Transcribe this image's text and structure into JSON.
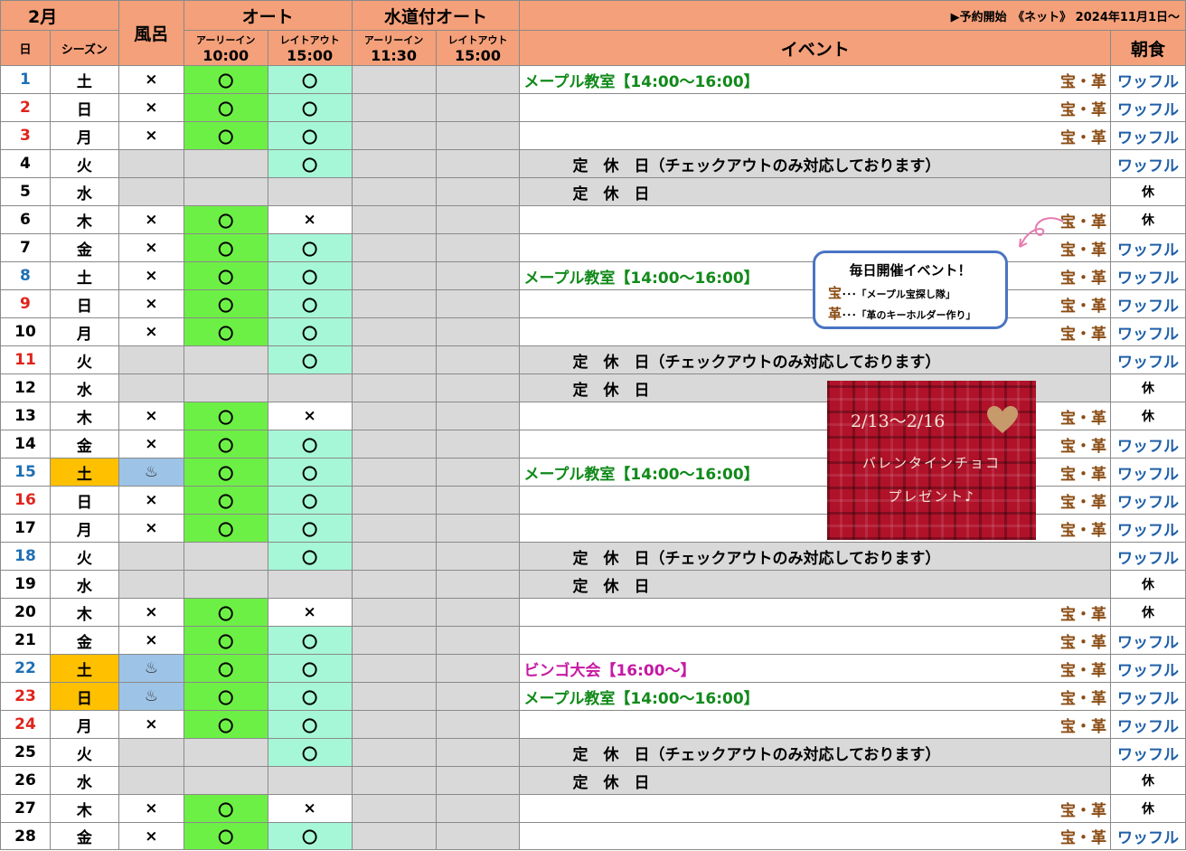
{
  "header": {
    "month": "2月",
    "bath": "風呂",
    "auto": "オート",
    "water_auto": "水道付オート",
    "notice": "▶予約開始　《ネット》 2024年11月1日～",
    "day_col": "日",
    "season_col": "シーズン",
    "early_in": "アーリーイン",
    "late_out": "レイトアウト",
    "auto_in_time": "10:00",
    "auto_out_time": "15:00",
    "water_in_time": "11:30",
    "water_out_time": "15:00",
    "event_col": "イベント",
    "breakfast_col": "朝食"
  },
  "text": {
    "closed_full": "定　休　日（チェックアウトのみ対応しております）",
    "closed": "定　休　日",
    "tags": "宝・革",
    "breakfast_waffle": "ワッフル",
    "breakfast_rest": "休",
    "mark_ok": "〇",
    "mark_ng": "×",
    "onsen": "♨"
  },
  "colors": {
    "header": "#f4a07a",
    "peak": "#ffc000",
    "green_bright": "#6df045",
    "green_mint": "#a6f7d7",
    "grey": "#d9d9d9",
    "blue_day": "#1f6fb4",
    "red_day": "#e0231b"
  },
  "callout": {
    "title": "毎日開催イベント！",
    "line1_key": "宝",
    "line1_text": "･･･「メープル宝探し隊」",
    "line2_key": "革",
    "line2_text": "･･･「革のキーホルダー作り」"
  },
  "valentine": {
    "dates": "2/13～2/16",
    "line1": "バレンタインチョコ",
    "line2": "プレゼント♪"
  },
  "rows": [
    {
      "day": "1",
      "dc": "blue",
      "wd": "土",
      "peak": false,
      "bath": "x",
      "ei": "o",
      "lo": "o",
      "type": "open",
      "event": "メープル教室【14:00～16:00】",
      "ec": "green",
      "tag": true,
      "bf": "w"
    },
    {
      "day": "2",
      "dc": "red",
      "wd": "日",
      "peak": false,
      "bath": "x",
      "ei": "o",
      "lo": "o",
      "type": "open",
      "event": "",
      "ec": "",
      "tag": true,
      "bf": "w"
    },
    {
      "day": "3",
      "dc": "red",
      "wd": "月",
      "peak": false,
      "bath": "x",
      "ei": "o",
      "lo": "o",
      "type": "open",
      "event": "",
      "ec": "",
      "tag": true,
      "bf": "w"
    },
    {
      "day": "4",
      "dc": "black",
      "wd": "火",
      "peak": false,
      "bath": "",
      "ei": "",
      "lo": "o",
      "type": "closed_co",
      "bf": "w"
    },
    {
      "day": "5",
      "dc": "black",
      "wd": "水",
      "peak": false,
      "bath": "",
      "ei": "",
      "lo": "",
      "type": "closed",
      "bf": "r"
    },
    {
      "day": "6",
      "dc": "black",
      "wd": "木",
      "peak": false,
      "bath": "x",
      "ei": "o",
      "lo": "x",
      "type": "open",
      "event": "",
      "ec": "",
      "tag": true,
      "bf": "r"
    },
    {
      "day": "7",
      "dc": "black",
      "wd": "金",
      "peak": false,
      "bath": "x",
      "ei": "o",
      "lo": "o",
      "type": "open",
      "event": "",
      "ec": "",
      "tag": true,
      "bf": "w"
    },
    {
      "day": "8",
      "dc": "blue",
      "wd": "土",
      "peak": false,
      "bath": "x",
      "ei": "o",
      "lo": "o",
      "type": "open",
      "event": "メープル教室【14:00～16:00】",
      "ec": "green",
      "tag": true,
      "bf": "w"
    },
    {
      "day": "9",
      "dc": "red",
      "wd": "日",
      "peak": false,
      "bath": "x",
      "ei": "o",
      "lo": "o",
      "type": "open",
      "event": "",
      "ec": "",
      "tag": true,
      "bf": "w"
    },
    {
      "day": "10",
      "dc": "black",
      "wd": "月",
      "peak": false,
      "bath": "x",
      "ei": "o",
      "lo": "o",
      "type": "open",
      "event": "",
      "ec": "",
      "tag": true,
      "bf": "w"
    },
    {
      "day": "11",
      "dc": "red",
      "wd": "火",
      "peak": false,
      "bath": "",
      "ei": "",
      "lo": "o",
      "type": "closed_co",
      "bf": "w"
    },
    {
      "day": "12",
      "dc": "black",
      "wd": "水",
      "peak": false,
      "bath": "",
      "ei": "",
      "lo": "",
      "type": "closed",
      "bf": "r"
    },
    {
      "day": "13",
      "dc": "black",
      "wd": "木",
      "peak": false,
      "bath": "x",
      "ei": "o",
      "lo": "x",
      "type": "open",
      "event": "",
      "ec": "",
      "tag": true,
      "bf": "r"
    },
    {
      "day": "14",
      "dc": "black",
      "wd": "金",
      "peak": false,
      "bath": "x",
      "ei": "o",
      "lo": "o",
      "type": "open",
      "event": "",
      "ec": "",
      "tag": true,
      "bf": "w"
    },
    {
      "day": "15",
      "dc": "blue",
      "wd": "土",
      "peak": true,
      "bath": "onsen",
      "ei": "o",
      "lo": "o",
      "type": "open",
      "event": "メープル教室【14:00～16:00】",
      "ec": "green",
      "tag": true,
      "bf": "w"
    },
    {
      "day": "16",
      "dc": "red",
      "wd": "日",
      "peak": false,
      "bath": "x",
      "ei": "o",
      "lo": "o",
      "type": "open",
      "event": "",
      "ec": "",
      "tag": true,
      "bf": "w"
    },
    {
      "day": "17",
      "dc": "black",
      "wd": "月",
      "peak": false,
      "bath": "x",
      "ei": "o",
      "lo": "o",
      "type": "open",
      "event": "",
      "ec": "",
      "tag": true,
      "bf": "w"
    },
    {
      "day": "18",
      "dc": "blue",
      "wd": "火",
      "peak": false,
      "bath": "",
      "ei": "",
      "lo": "o",
      "type": "closed_co",
      "bf": "w"
    },
    {
      "day": "19",
      "dc": "black",
      "wd": "水",
      "peak": false,
      "bath": "",
      "ei": "",
      "lo": "",
      "type": "closed",
      "bf": "r"
    },
    {
      "day": "20",
      "dc": "black",
      "wd": "木",
      "peak": false,
      "bath": "x",
      "ei": "o",
      "lo": "x",
      "type": "open",
      "event": "",
      "ec": "",
      "tag": true,
      "bf": "r"
    },
    {
      "day": "21",
      "dc": "black",
      "wd": "金",
      "peak": false,
      "bath": "x",
      "ei": "o",
      "lo": "o",
      "type": "open",
      "event": "",
      "ec": "",
      "tag": true,
      "bf": "w"
    },
    {
      "day": "22",
      "dc": "blue",
      "wd": "土",
      "peak": true,
      "bath": "onsen",
      "ei": "o",
      "lo": "o",
      "type": "open",
      "event": "ビンゴ大会【16:00～】",
      "ec": "magenta",
      "tag": true,
      "bf": "w"
    },
    {
      "day": "23",
      "dc": "red",
      "wd": "日",
      "peak": true,
      "bath": "onsen",
      "ei": "o",
      "lo": "o",
      "type": "open",
      "event": "メープル教室【14:00～16:00】",
      "ec": "green",
      "tag": true,
      "bf": "w"
    },
    {
      "day": "24",
      "dc": "red",
      "wd": "月",
      "peak": false,
      "bath": "x",
      "ei": "o",
      "lo": "o",
      "type": "open",
      "event": "",
      "ec": "",
      "tag": true,
      "bf": "w"
    },
    {
      "day": "25",
      "dc": "black",
      "wd": "火",
      "peak": false,
      "bath": "",
      "ei": "",
      "lo": "o",
      "type": "closed_co",
      "bf": "w"
    },
    {
      "day": "26",
      "dc": "black",
      "wd": "水",
      "peak": false,
      "bath": "",
      "ei": "",
      "lo": "",
      "type": "closed",
      "bf": "r"
    },
    {
      "day": "27",
      "dc": "black",
      "wd": "木",
      "peak": false,
      "bath": "x",
      "ei": "o",
      "lo": "x",
      "type": "open",
      "event": "",
      "ec": "",
      "tag": true,
      "bf": "r"
    },
    {
      "day": "28",
      "dc": "black",
      "wd": "金",
      "peak": false,
      "bath": "x",
      "ei": "o",
      "lo": "o",
      "type": "open",
      "event": "",
      "ec": "",
      "tag": true,
      "bf": "w"
    }
  ]
}
